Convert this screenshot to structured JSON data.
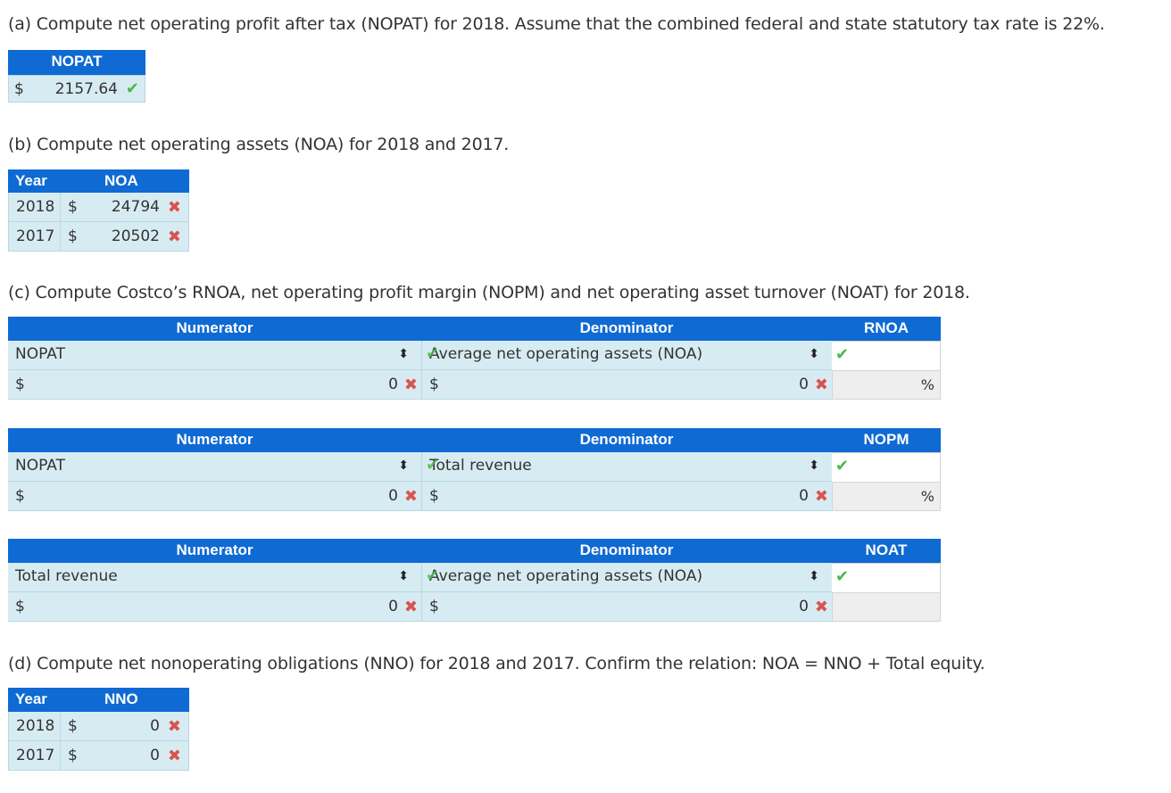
{
  "a": {
    "question": "(a) Compute net operating profit after tax (NOPAT) for 2018. Assume that the combined federal and state statutory tax rate is 22%.",
    "header": "NOPAT",
    "currency": "$",
    "value": "2157.64",
    "status": "correct"
  },
  "b": {
    "question": "(b) Compute net operating assets (NOA) for 2018 and 2017.",
    "headers": [
      "Year",
      "NOA"
    ],
    "rows": [
      {
        "year": "2018",
        "currency": "$",
        "value": "24794",
        "status": "incorrect"
      },
      {
        "year": "2017",
        "currency": "$",
        "value": "20502",
        "status": "incorrect"
      }
    ]
  },
  "c": {
    "question": "(c) Compute Costco’s RNOA, net operating profit margin (NOPM) and net operating asset turnover (NOAT) for 2018.",
    "tables": [
      {
        "headers": [
          "Numerator",
          "Denominator",
          "RNOA"
        ],
        "numerator_select": "NOPAT",
        "denominator_select": "Average net operating assets (NOA)",
        "numerator_currency": "$",
        "numerator_value": "0",
        "denominator_currency": "$",
        "denominator_value": "0",
        "result_unit": "%"
      },
      {
        "headers": [
          "Numerator",
          "Denominator",
          "NOPM"
        ],
        "numerator_select": "NOPAT",
        "denominator_select": "Total revenue",
        "numerator_currency": "$",
        "numerator_value": "0",
        "denominator_currency": "$",
        "denominator_value": "0",
        "result_unit": "%"
      },
      {
        "headers": [
          "Numerator",
          "Denominator",
          "NOAT"
        ],
        "numerator_select": "Total revenue",
        "denominator_select": "Average net operating assets (NOA)",
        "numerator_currency": "$",
        "numerator_value": "0",
        "denominator_currency": "$",
        "denominator_value": "0",
        "result_unit": ""
      }
    ]
  },
  "d": {
    "question": "(d) Compute net nonoperating obligations (NNO) for 2018 and 2017. Confirm the relation: NOA = NNO + Total equity.",
    "headers": [
      "Year",
      "NNO"
    ],
    "rows": [
      {
        "year": "2018",
        "currency": "$",
        "value": "0",
        "status": "incorrect"
      },
      {
        "year": "2017",
        "currency": "$",
        "value": "0",
        "status": "incorrect"
      }
    ]
  },
  "icons": {
    "check": "✔",
    "x": "✖",
    "updown": "⬍"
  },
  "colors": {
    "header_blue": "#0f6ad3",
    "cell_blue": "#d7ecf2",
    "correct_green": "#4cb84c",
    "incorrect_red": "#d9534f"
  }
}
